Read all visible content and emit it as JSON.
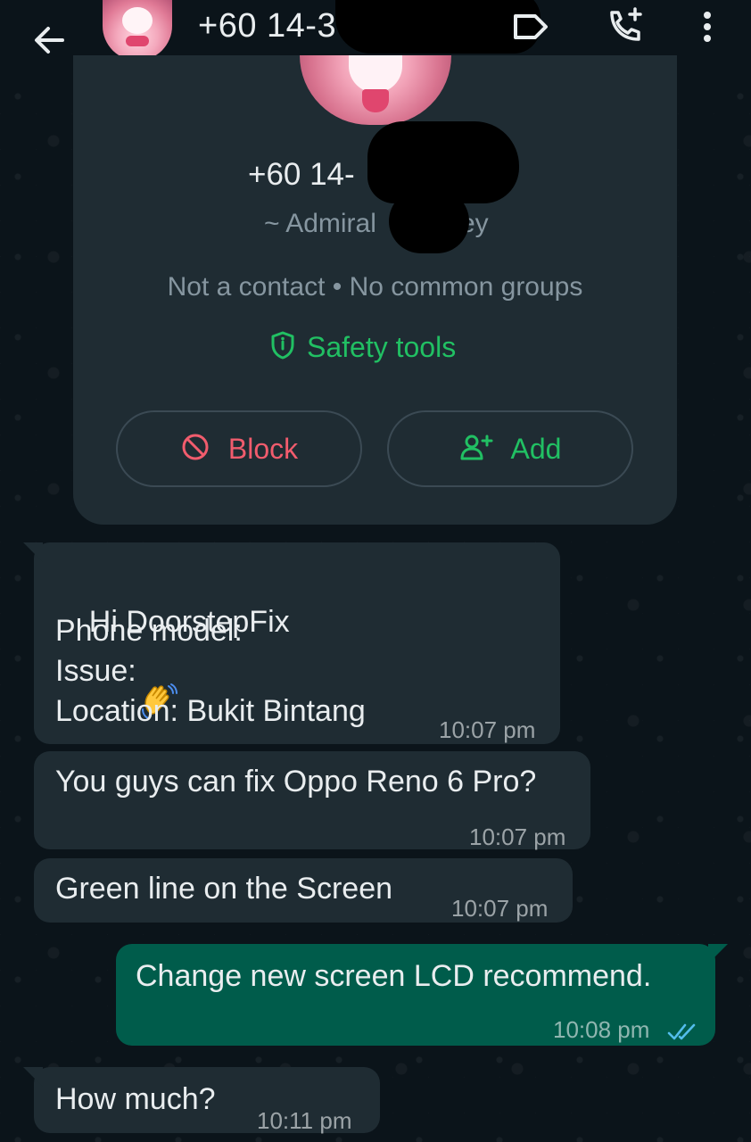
{
  "header": {
    "title": "+60 14-3"
  },
  "contact_card": {
    "number": "+60 14-",
    "name_prefix": "~ Admiral",
    "name_suffix": "ey",
    "subtitle": "Not a contact • No common groups",
    "safety_tools": "Safety tools",
    "block_label": "Block",
    "add_label": "Add"
  },
  "messages": [
    {
      "direction": "incoming",
      "lines": [
        "Hi DoorstepFix",
        "Phone model:",
        "Issue:",
        "Location: Bukit Bintang"
      ],
      "time": "10:07 pm"
    },
    {
      "direction": "incoming",
      "text": "You guys can fix Oppo Reno 6 Pro?",
      "time": "10:07 pm"
    },
    {
      "direction": "incoming",
      "text": "Green line on the Screen",
      "time": "10:07 pm"
    },
    {
      "direction": "outgoing",
      "text": "Change new screen LCD recommend.",
      "time": "10:08 pm",
      "status": "read"
    },
    {
      "direction": "incoming",
      "text": "How much?",
      "time": "10:11 pm"
    }
  ],
  "colors": {
    "accent_green": "#21c063",
    "block_red": "#f15c6d",
    "incoming_bubble": "#1f2c33",
    "outgoing_bubble": "#005c4b",
    "read_ticks": "#53bdeb"
  }
}
